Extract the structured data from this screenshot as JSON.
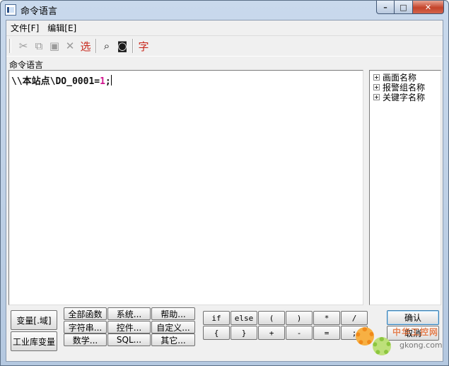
{
  "window": {
    "title": "命令语言"
  },
  "menu": [
    {
      "label": "文件[F]"
    },
    {
      "label": "编辑[E]"
    }
  ],
  "toolbar": {
    "select_label": "选",
    "font_label": "字"
  },
  "section_label": "命令语言",
  "editor": {
    "code_text": "\\\\本站点\\DO_0001=",
    "code_value": "1",
    "code_end": ";"
  },
  "tree": [
    {
      "label": "画面名称"
    },
    {
      "label": "报警组名称"
    },
    {
      "label": "关键字名称"
    }
  ],
  "left_buttons": {
    "var_domain": "变量[.域]",
    "industrial_var": "工业库变量"
  },
  "function_buttons": {
    "all_functions": "全部函数",
    "system": "系统...",
    "help": "帮助...",
    "string": "字符串...",
    "control": "控件...",
    "custom": "自定义...",
    "math": "数学...",
    "sql": "SQL...",
    "other": "其它..."
  },
  "operator_buttons": {
    "row1": [
      "if",
      "else",
      "(",
      ")",
      "*",
      "/"
    ],
    "row2": [
      "{",
      "}",
      "+",
      "-",
      "=",
      ";"
    ]
  },
  "dialog_buttons": {
    "confirm": "确认",
    "cancel": "取消"
  },
  "watermark": {
    "line1": "中华工控网",
    "line2": "gkong.com"
  },
  "colors": {
    "code_number": "#d0148e",
    "toolbar_red": "#c8281c"
  }
}
